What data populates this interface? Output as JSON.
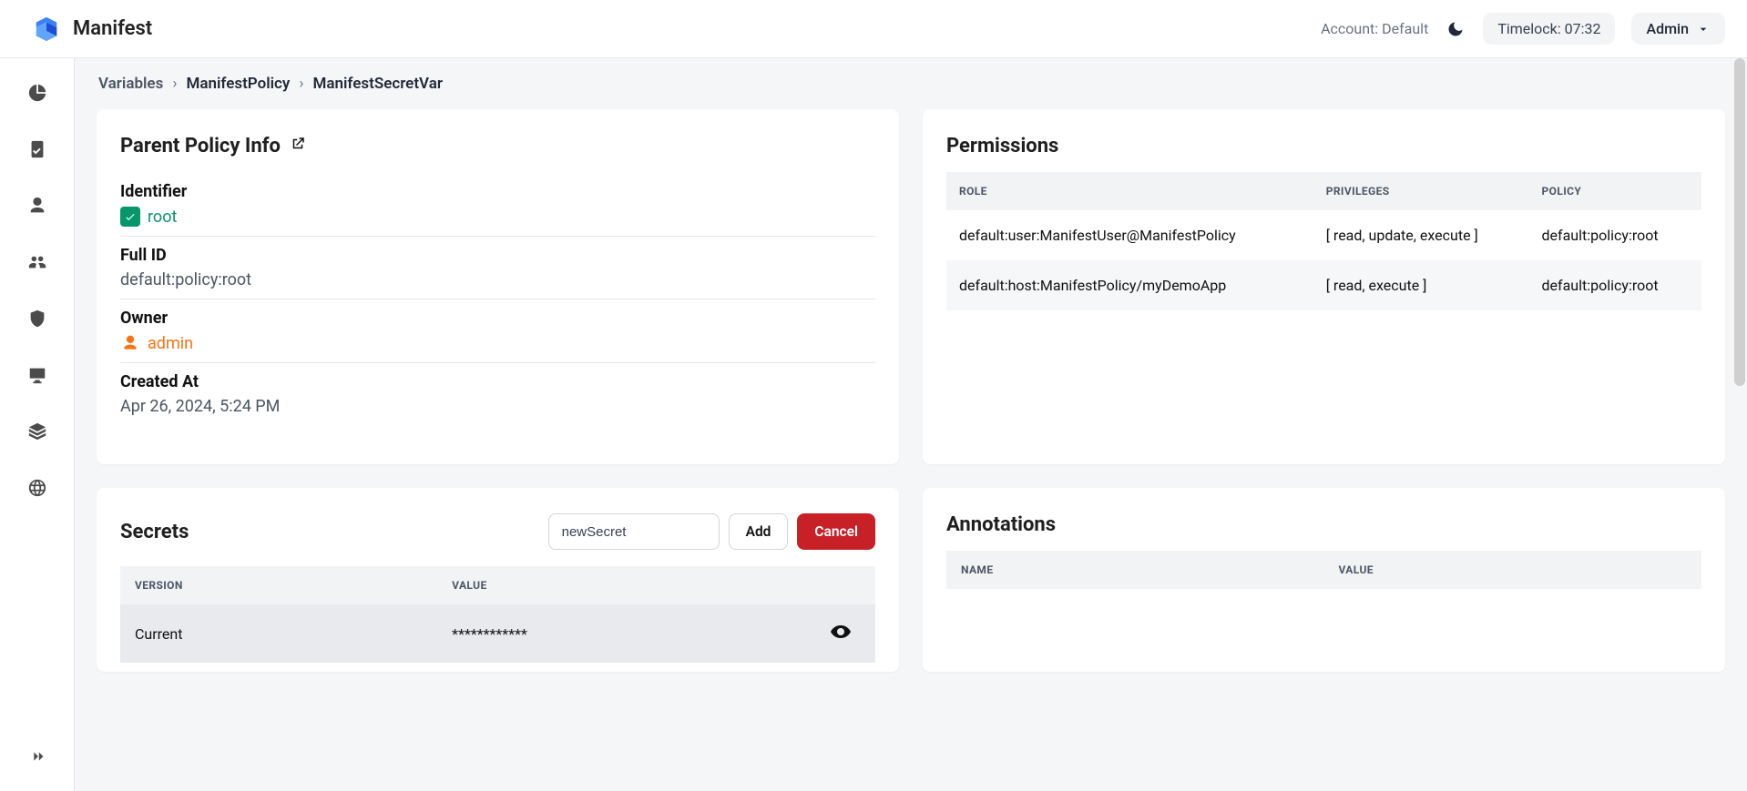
{
  "brand": "Manifest",
  "topbar": {
    "account_label": "Account: Default",
    "timelock": "Timelock: 07:32",
    "admin_label": "Admin"
  },
  "breadcrumb": {
    "root": "Variables",
    "policy": "ManifestPolicy",
    "current": "ManifestSecretVar"
  },
  "parent_policy": {
    "card_title": "Parent Policy Info",
    "identifier_label": "Identifier",
    "identifier_value": "root",
    "fullid_label": "Full ID",
    "fullid_value": "default:policy:root",
    "owner_label": "Owner",
    "owner_value": "admin",
    "created_label": "Created At",
    "created_value": "Apr 26, 2024, 5:24 PM"
  },
  "permissions": {
    "card_title": "Permissions",
    "col_role": "ROLE",
    "col_priv": "PRIVILEGES",
    "col_policy": "POLICY",
    "rows": [
      {
        "role": "default:user:ManifestUser@ManifestPolicy",
        "priv": "[ read, update, execute ]",
        "policy": "default:policy:root"
      },
      {
        "role": "default:host:ManifestPolicy/myDemoApp",
        "priv": "[ read, execute ]",
        "policy": "default:policy:root"
      }
    ]
  },
  "secrets": {
    "card_title": "Secrets",
    "input_value": "newSecret",
    "add_label": "Add",
    "cancel_label": "Cancel",
    "col_version": "VERSION",
    "col_value": "VALUE",
    "rows": [
      {
        "version": "Current",
        "value": "************"
      }
    ]
  },
  "annotations": {
    "card_title": "Annotations",
    "col_name": "NAME",
    "col_value": "VALUE"
  }
}
